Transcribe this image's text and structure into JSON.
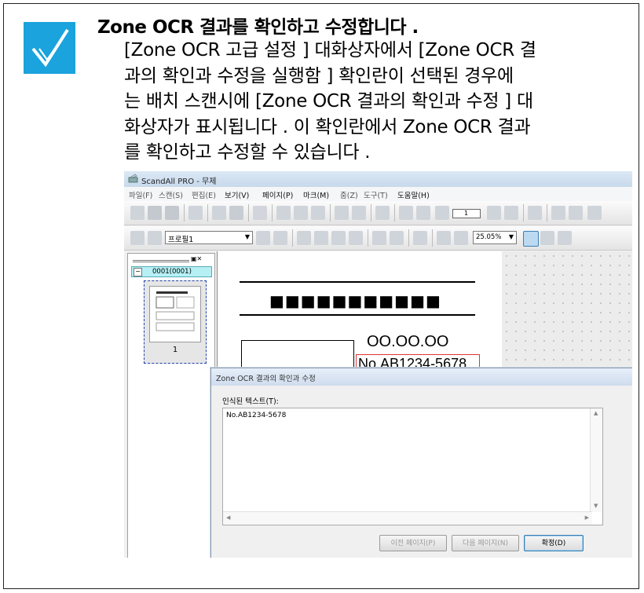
{
  "note": {
    "heading": "Zone OCR 결과를 확인하고 수정합니다 .",
    "lines": [
      "[Zone OCR 고급 설정 ] 대화상자에서 [Zone OCR 결",
      "과의 확인과 수정을 실행함 ] 확인란이 선택된 경우에",
      "는 배치 스캔시에 [Zone OCR 결과의 확인과 수정 ] 대",
      "화상자가 표시됩니다 . 이 확인란에서 Zone OCR 결과",
      "를 확인하고 수정할 수 있습니다 ."
    ],
    "check_color": "#1aa3dc"
  },
  "app": {
    "title": "ScandAll PRO - 무제",
    "menu": [
      "파일(F)",
      "스캔(S)",
      "편집(E)",
      "보기(V)",
      "페이지(P)",
      "마크(M)",
      "줌(Z)",
      "도구(T)",
      "도움말(H)"
    ],
    "profile_combo": "프로필1",
    "zoom_combo": "25.05%",
    "page_box": "1"
  },
  "thumbnails": {
    "tree_label": "0001(0001)",
    "page_number": "1"
  },
  "document": {
    "date_text": "OO.OO.OO",
    "ocr_zone_text": "No.AB1234-5678",
    "barcode_text": "■■■■■■■■■■■"
  },
  "dialog": {
    "title": "Zone OCR 결과의 확인과 수정",
    "label": "인식된 텍스트(T):",
    "recognized_text": "No.AB1234-5678",
    "prev_button": "이전 페이지(P)",
    "next_button": "다음 페이지(N)",
    "ok_button": "확정(D)"
  }
}
